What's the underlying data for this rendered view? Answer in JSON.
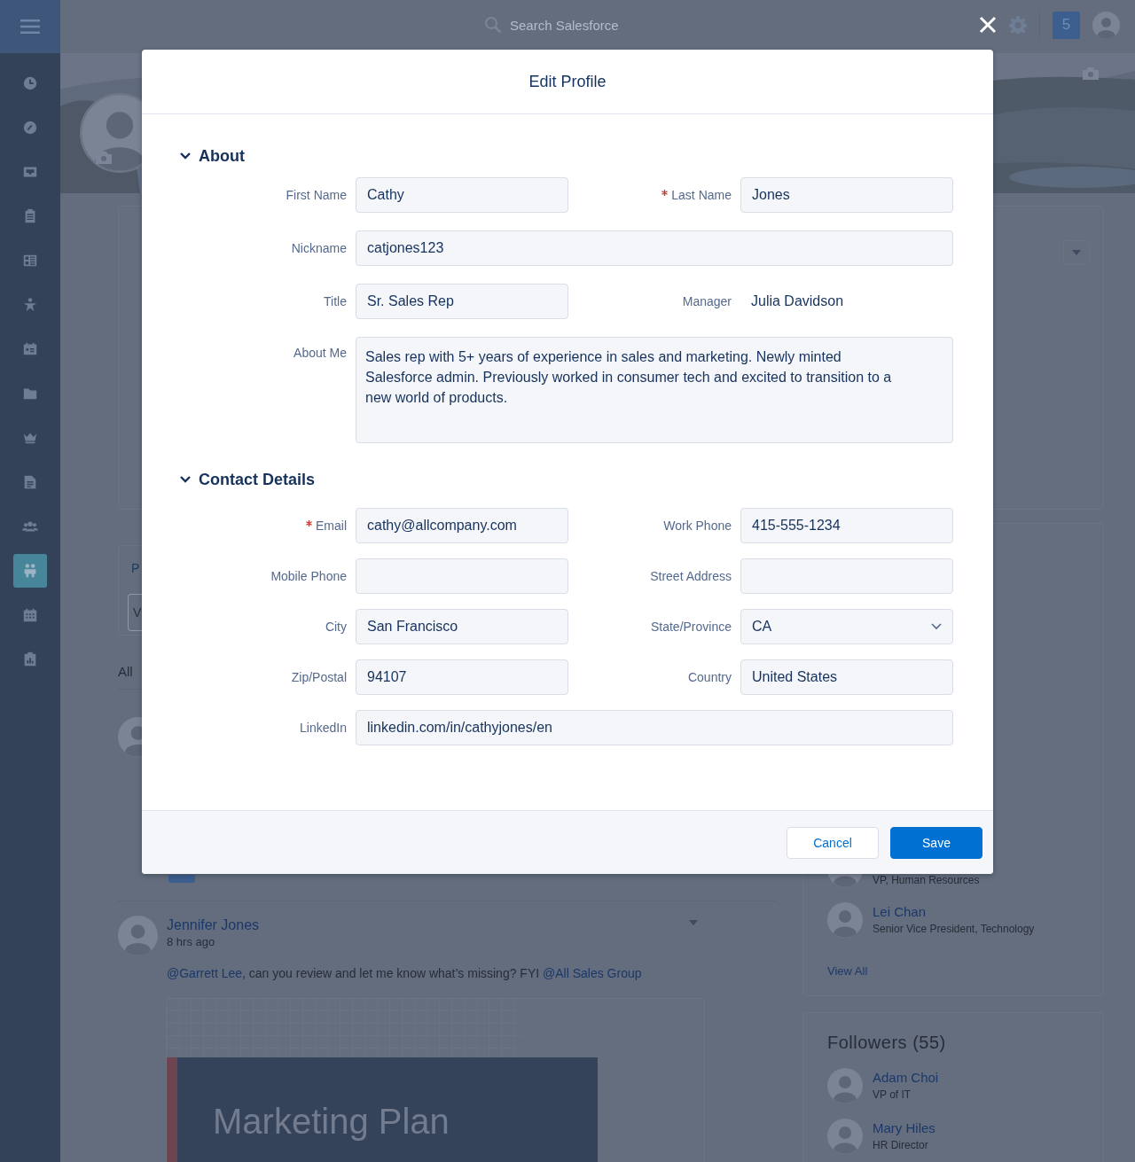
{
  "global_header": {
    "search": {
      "placeholder": "Search Salesforce"
    },
    "notifications": "5"
  },
  "nav": [
    {
      "selected": false
    },
    {
      "selected": false
    },
    {
      "selected": false
    },
    {
      "selected": false
    },
    {
      "selected": false
    },
    {
      "selected": false
    },
    {
      "selected": false
    },
    {
      "selected": false
    },
    {
      "selected": false
    },
    {
      "selected": false
    },
    {
      "selected": false
    },
    {
      "selected": true
    },
    {
      "selected": false
    },
    {
      "selected": false
    }
  ],
  "feed": {
    "publisher": {
      "tab_fragment": "P",
      "field_fragment": "V"
    },
    "filter_fragment": "All",
    "post": {
      "author": "Jennifer Jones",
      "time": "8 hrs ago",
      "message": [
        {
          "kind": "mention",
          "text": "@Garrett Lee"
        },
        {
          "kind": "text",
          "text": ", can you review and let me know what’s missing? FYI "
        },
        {
          "kind": "mention",
          "text": "@All Sales Group"
        }
      ],
      "attachment": {
        "title": "Marketing Plan"
      }
    }
  },
  "people_card": {
    "people": [
      {
        "title": "VP, Human Resources"
      },
      {
        "name": "Lei Chan",
        "title": "Senior Vice President, Technology"
      }
    ],
    "link": "View All"
  },
  "followers": {
    "title": "Followers (55)",
    "people": [
      {
        "name": "Adam Choi",
        "title": "VP of IT"
      },
      {
        "name": "Mary Hiles",
        "title": "HR Director"
      }
    ]
  },
  "modal": {
    "title": "Edit Profile",
    "sections": [
      {
        "title": "About",
        "expanded": true,
        "fields": [
          {
            "kind": "input",
            "label": "First Name",
            "value": "Cathy",
            "required": false
          },
          {
            "kind": "input",
            "label": "Last Name",
            "value": "Jones",
            "required": true
          },
          {
            "kind": "wide-input",
            "label": "Nickname",
            "value": "catjones123",
            "required": false
          },
          {
            "kind": "input",
            "label": "Title",
            "value": "Sr. Sales Rep",
            "required": false
          },
          {
            "kind": "static",
            "label": "Manager",
            "value": "Julia Davidson",
            "required": false
          },
          {
            "kind": "textarea",
            "label": "About Me",
            "value": "Sales rep with 5+ years of experience in sales and marketing. Newly minted Salesforce admin. Previously worked in consumer tech and excited to transition to a new world of products.",
            "required": false
          }
        ]
      },
      {
        "title": "Contact Details",
        "expanded": true,
        "fields": [
          {
            "kind": "input",
            "label": "Email",
            "value": "cathy@allcompany.com",
            "required": true
          },
          {
            "kind": "input",
            "label": "Work Phone",
            "value": "415-555-1234",
            "required": false
          },
          {
            "kind": "input",
            "label": "Mobile Phone",
            "required": false
          },
          {
            "kind": "input",
            "label": "Street Address",
            "required": false
          },
          {
            "kind": "input",
            "label": "City",
            "value": "San Francisco",
            "required": false
          },
          {
            "kind": "select",
            "label": "State/Province",
            "value": "CA",
            "required": false
          },
          {
            "kind": "input",
            "label": "Zip/Postal",
            "value": "94107",
            "required": false
          },
          {
            "kind": "input",
            "label": "Country",
            "value": "United States",
            "required": false
          },
          {
            "kind": "wide-input",
            "label": "LinkedIn",
            "value": "linkedin.com/in/cathyjones/en",
            "required": false
          }
        ]
      }
    ],
    "buttons": [
      {
        "label": "Cancel",
        "kind": "neutral"
      },
      {
        "label": "Save",
        "kind": "brand"
      }
    ]
  }
}
